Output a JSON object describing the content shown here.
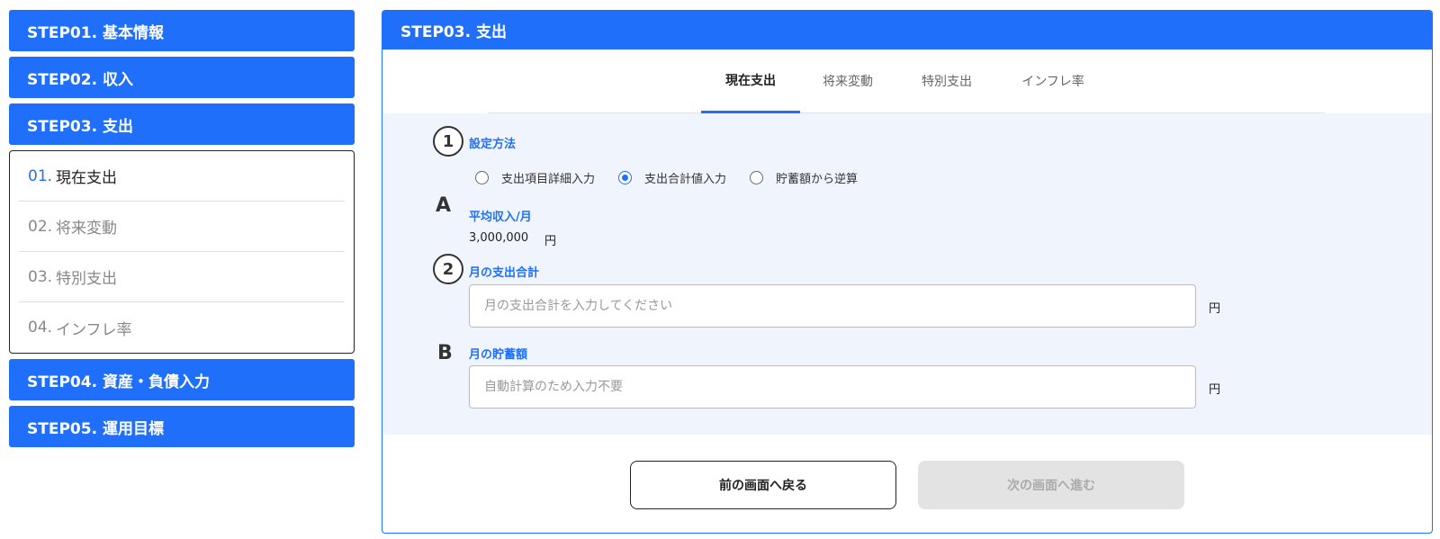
{
  "sidebar": {
    "steps": [
      {
        "label": "STEP01. 基本情報"
      },
      {
        "label": "STEP02. 収入"
      },
      {
        "label": "STEP03. 支出"
      },
      {
        "label": "STEP04. 資産・負債入力"
      },
      {
        "label": "STEP05. 運用目標"
      }
    ],
    "substeps": [
      {
        "num": "01.",
        "label": "現在支出"
      },
      {
        "num": "02.",
        "label": "将来変動"
      },
      {
        "num": "03.",
        "label": "特別支出"
      },
      {
        "num": "04.",
        "label": "インフレ率"
      }
    ]
  },
  "panel": {
    "title": "STEP03. 支出",
    "tabs": [
      "現在支出",
      "将来変動",
      "特別支出",
      "インフレ率"
    ]
  },
  "form": {
    "marker1": "1",
    "method_label": "設定方法",
    "radio_options": [
      "支出項目詳細入力",
      "支出合計値入力",
      "貯蓄額から逆算"
    ],
    "radio_selected": "支出合計値入力",
    "markerA": "A",
    "avg_income_label": "平均収入/月",
    "avg_income_value": "3,000,000",
    "avg_income_unit": "円",
    "marker2": "2",
    "monthly_total_label": "月の支出合計",
    "monthly_total_placeholder": "月の支出合計を入力してください",
    "monthly_total_unit": "円",
    "markerB": "B",
    "monthly_savings_label": "月の貯蓄額",
    "monthly_savings_placeholder": "自動計算のため入力不要",
    "monthly_savings_unit": "円"
  },
  "buttons": {
    "prev": "前の画面へ戻る",
    "next": "次の画面へ進む"
  },
  "colors": {
    "accent": "#1f6ffb",
    "form_bg": "#f0f5fd",
    "disabled": "#e3e3e3"
  }
}
